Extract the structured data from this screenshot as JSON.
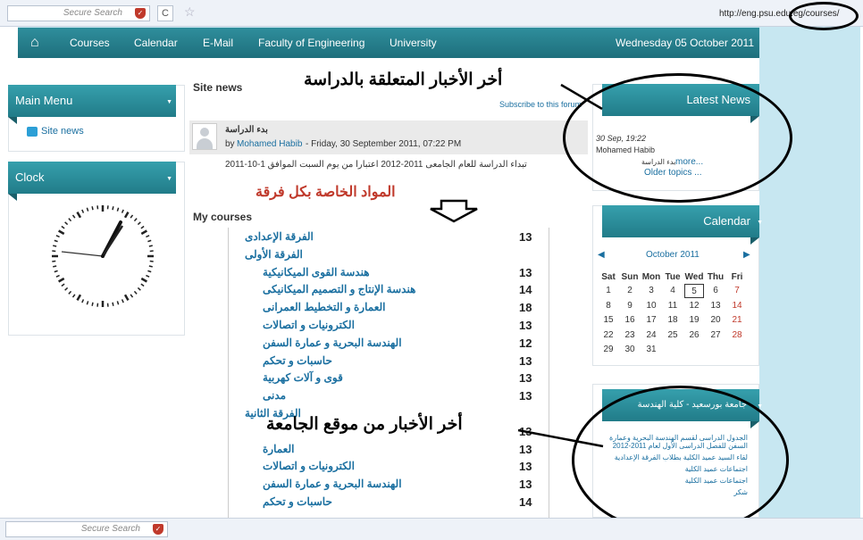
{
  "browser": {
    "search_placeholder": "Secure Search",
    "reload": "C",
    "url": "http://eng.psu.edu.eg/courses/",
    "status_search": "Secure Search"
  },
  "nav": {
    "items": [
      "Courses",
      "Calendar",
      "E-Mail",
      "Faculty of Engineering",
      "University"
    ],
    "date": "Wednesday 05 October 2011"
  },
  "main_menu": {
    "title": "Main Menu",
    "item": "Site news"
  },
  "clock": {
    "title": "Clock"
  },
  "site_news": {
    "title": "Site news",
    "subscribe": "Subscribe to this forum",
    "post_subject": "بدء الدراسة",
    "post_by": "by",
    "post_author": "Mohamed Habib",
    "post_date": "- Friday, 30 September 2011, 07:22 PM",
    "post_body": "تبداء الدراسة للعام الجامعى 2011-2012 اعتبارا من يوم السبت الموافق 1-10-2011"
  },
  "my_courses": {
    "title": "My courses",
    "rows": [
      {
        "name": "الفرقة الإعدادى",
        "count": "13"
      },
      {
        "name": "الفرقة الأولى",
        "count": ""
      },
      {
        "name": "هندسة القوى الميكانيكية",
        "count": "13"
      },
      {
        "name": "هندسة الإنتاج و التصميم الميكانيكى",
        "count": "14"
      },
      {
        "name": "العمارة و التخطيط العمرانى",
        "count": "18"
      },
      {
        "name": "الكترونيات و اتصالات",
        "count": "13"
      },
      {
        "name": "الهندسة البحرية و عمارة السفن",
        "count": "12"
      },
      {
        "name": "حاسبات و تحكم",
        "count": "13"
      },
      {
        "name": "قوى و آلات كهربية",
        "count": "13"
      },
      {
        "name": "مدنى",
        "count": "13"
      },
      {
        "name": "الفرقة الثانية",
        "count": ""
      },
      {
        "name": "",
        "count": "13"
      },
      {
        "name": "العمارة",
        "count": "13"
      },
      {
        "name": "الكترونيات و اتصالات",
        "count": "13"
      },
      {
        "name": "الهندسة البحرية و عمارة السفن",
        "count": "13"
      },
      {
        "name": "حاسبات و تحكم",
        "count": "14"
      }
    ]
  },
  "latest_news": {
    "title": "Latest News",
    "date": "30 Sep, 19:22",
    "author": "Mohamed Habib",
    "subject": "بدء الدراسة",
    "more": "more...",
    "older": "Older topics ..."
  },
  "calendar": {
    "title": "Calendar",
    "month": "October 2011",
    "days": [
      "Sat",
      "Sun",
      "Mon",
      "Tue",
      "Wed",
      "Thu",
      "Fri"
    ],
    "weeks": [
      [
        "1",
        "2",
        "3",
        "4",
        "5",
        "6",
        "7"
      ],
      [
        "8",
        "9",
        "10",
        "11",
        "12",
        "13",
        "14"
      ],
      [
        "15",
        "16",
        "17",
        "18",
        "19",
        "20",
        "21"
      ],
      [
        "22",
        "23",
        "24",
        "25",
        "26",
        "27",
        "28"
      ],
      [
        "29",
        "30",
        "31",
        "",
        "",
        "",
        ""
      ]
    ],
    "today": "5",
    "weekend_color": "#c0392b"
  },
  "university_news": {
    "title": "جامعة بورسعيد - كلية الهندسة",
    "items": [
      "الجدول الدراسى لقسم الهندسة البحرية وعمارة السفن للفصل الدراسى الأول لعام 2011-2012",
      "لقاء السيد عميد الكلية بطلاب الفرقة الإعدادية",
      "اجتماعات عميد الكلية",
      "اجتماعات عميد الكلية",
      "شكر"
    ]
  },
  "annotations": {
    "latest": "أخر الأخبار المتعلقة بالدراسة",
    "courses": "المواد الخاصة بكل فرقة",
    "university": "أخر الأخبار من موقع الجامعة"
  },
  "colors": {
    "header": "#217c89",
    "link": "#1a6fa0",
    "page_bg": "#c7e7f1",
    "annotation_red": "#c0392b"
  }
}
